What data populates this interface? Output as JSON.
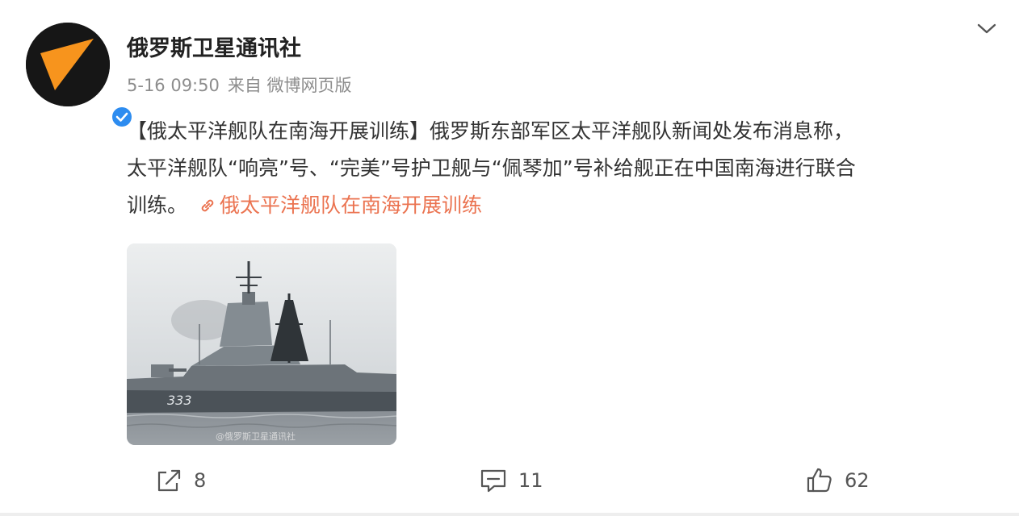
{
  "post": {
    "username": "俄罗斯卫星通讯社",
    "date": "5-16 09:50",
    "source": "来自 微博网页版",
    "text_line1": "【俄太平洋舰队在南海开展训练】俄罗斯东部军区太平洋舰队新闻处发布消息称，",
    "text_line2": "太平洋舰队“响亮”号、“完美”号护卫舰与“佩琴加”号补给舰正在中国南海进行联合",
    "text_line3": "训练。",
    "link_text": "俄太平洋舰队在南海开展训练",
    "image": {
      "hull_number": "333",
      "watermark": "@俄罗斯卫星通讯社"
    }
  },
  "actions": {
    "share_count": "8",
    "comment_count": "11",
    "like_count": "62"
  },
  "icons": {
    "avatar": "sputnik-logo-icon",
    "verified": "verified-badge-icon",
    "menu": "chevron-down-icon",
    "link": "link-icon",
    "share": "share-icon",
    "comment": "comment-icon",
    "like": "thumbs-up-icon"
  },
  "colors": {
    "accent": "#eb7350",
    "logo_orange": "#f7941d",
    "verified_blue": "#2d8cf0",
    "meta_gray": "#8d8d8d"
  }
}
